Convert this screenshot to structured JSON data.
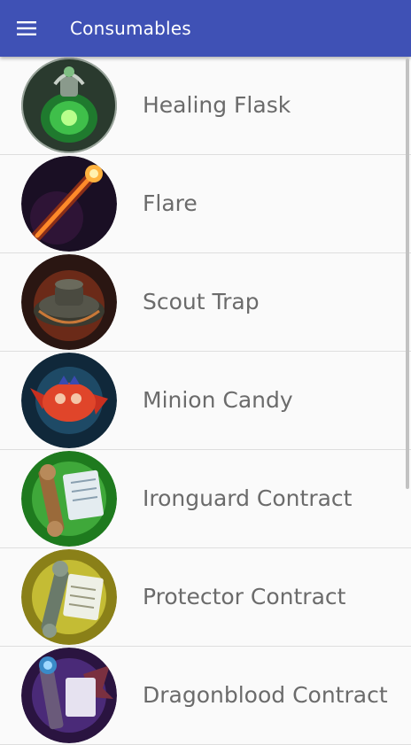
{
  "app_bar": {
    "title": "Consumables",
    "menu_icon": "hamburger-menu-icon",
    "color": "#3f51b5"
  },
  "items": [
    {
      "name": "Healing Flask",
      "icon": "healing-flask-icon"
    },
    {
      "name": "Flare",
      "icon": "flare-icon"
    },
    {
      "name": "Scout Trap",
      "icon": "scout-trap-icon"
    },
    {
      "name": "Minion Candy",
      "icon": "minion-candy-icon"
    },
    {
      "name": "Ironguard Contract",
      "icon": "ironguard-contract-icon"
    },
    {
      "name": "Protector Contract",
      "icon": "protector-contract-icon"
    },
    {
      "name": "Dragonblood Contract",
      "icon": "dragonblood-contract-icon"
    }
  ]
}
